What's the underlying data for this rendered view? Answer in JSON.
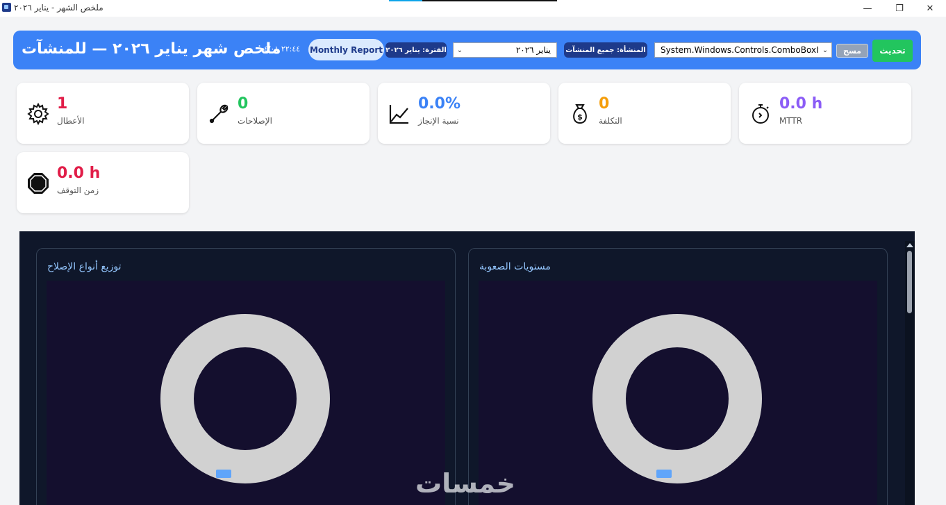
{
  "window": {
    "title": "ملخص الشهر - يناير ٢٠٢٦",
    "minimize": "—",
    "maximize": "❐",
    "close": "✕"
  },
  "header": {
    "refresh_label": "تحديث",
    "clear_label": "مسح",
    "facility_combo_value": "System.Windows.Controls.ComboBoxItem",
    "facility_chip": "المنشأة: جميع المنشآت",
    "period_combo_value": "يناير ٢٠٢٦",
    "period_chip": "الفترة: يناير ٢٠٢٦",
    "report_button": "Monthly Report",
    "timestamp": "٢٢:٤٤ ٠٤/٠١",
    "title": "ملخص شهر يناير ٢٠٢٦ — للمنشآت",
    "background": "#3b82f6"
  },
  "kpis": [
    {
      "label": "الأعطال",
      "value": "1",
      "icon": "gear-icon",
      "color": "#e11d48"
    },
    {
      "label": "الإصلاحات",
      "value": "0",
      "icon": "wrench-icon",
      "color": "#22c55e"
    },
    {
      "label": "نسبة الإنجاز",
      "value": "0.0%",
      "icon": "chart-line-icon",
      "color": "#3b82f6"
    },
    {
      "label": "التكلفة",
      "value": "0",
      "icon": "money-bag-icon",
      "color": "#f59e0b"
    },
    {
      "label": "MTTR",
      "value": "0.0 h",
      "icon": "stopwatch-icon",
      "color": "#8b5cf6"
    },
    {
      "label": "زمن التوقف",
      "value": "0.0 h",
      "icon": "stop-sign-icon",
      "color": "#e11d48"
    }
  ],
  "charts": {
    "repair_types_title": "توزيع أنواع الإصلاح",
    "difficulty_title": "مستويات الصعوبة"
  },
  "chart_data": [
    {
      "type": "pie",
      "title": "توزيع أنواع الإصلاح",
      "categories": [],
      "values": []
    },
    {
      "type": "pie",
      "title": "مستويات الصعوبة",
      "categories": [],
      "values": []
    }
  ],
  "watermark": "خمسات"
}
